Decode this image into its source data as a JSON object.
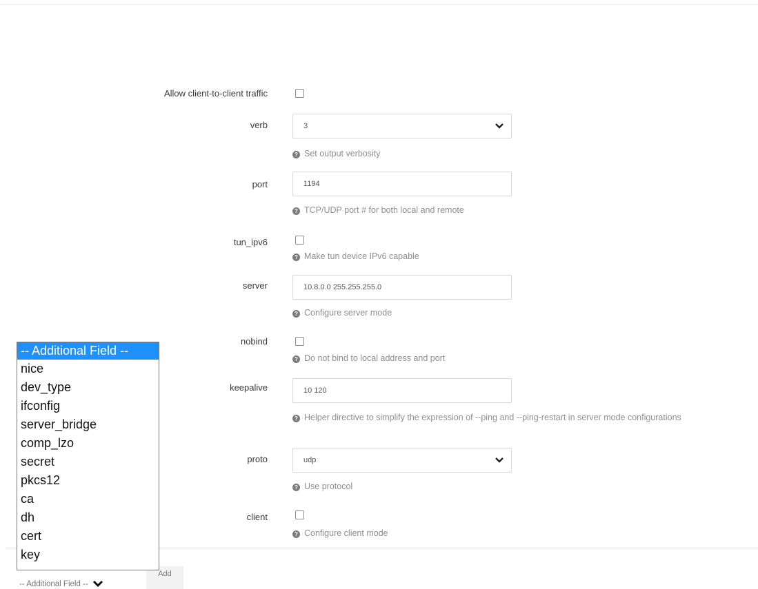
{
  "form": {
    "fields": {
      "client_to_client": {
        "label": "Allow client-to-client traffic"
      },
      "verb": {
        "label": "verb",
        "value": "3",
        "help": "Set output verbosity"
      },
      "port": {
        "label": "port",
        "value": "1194",
        "help": "TCP/UDP port # for both local and remote"
      },
      "tun_ipv6": {
        "label": "tun_ipv6",
        "help": "Make tun device IPv6 capable"
      },
      "server": {
        "label": "server",
        "value": "10.8.0.0 255.255.255.0",
        "help": "Configure server mode"
      },
      "nobind": {
        "label": "nobind",
        "help": "Do not bind to local address and port"
      },
      "keepalive": {
        "label": "keepalive",
        "value": "10 120",
        "help": "Helper directive to simplify the expression of --ping and --ping-restart in server mode configurations"
      },
      "proto": {
        "label": "proto",
        "value": "udp",
        "help": "Use protocol"
      },
      "client": {
        "label": "client",
        "help": "Configure client mode"
      }
    }
  },
  "additional_field_dropdown": {
    "selected": "-- Additional Field --",
    "options": [
      "nice",
      "dev_type",
      "ifconfig",
      "server_bridge",
      "comp_lzo",
      "secret",
      "pkcs12",
      "ca",
      "dh",
      "cert",
      "key"
    ]
  },
  "bottom_bar": {
    "select_label": "-- Additional Field --",
    "add_label": "Add"
  },
  "icons": {
    "help": "question-circle-icon",
    "dropdown": "chevron-down-icon"
  },
  "colors": {
    "selected_option_bg": "#1e90ff",
    "help_text": "#8e8e8e"
  }
}
